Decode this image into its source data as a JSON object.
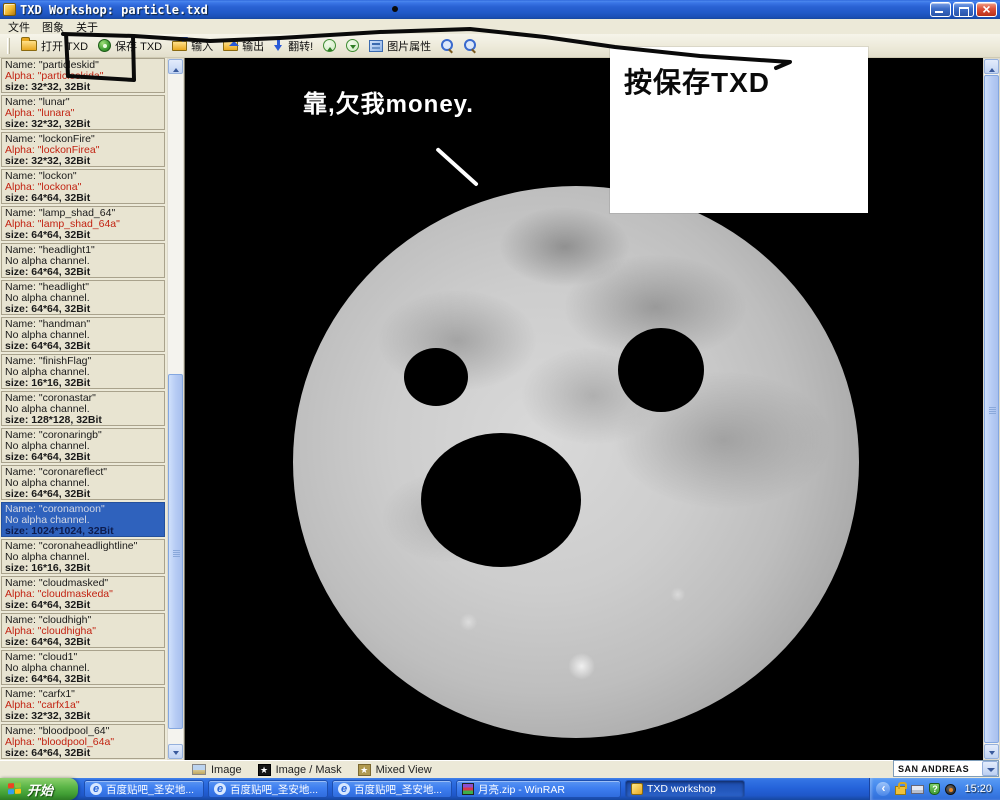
{
  "titlebar": {
    "title": "TXD Workshop: particle.txd"
  },
  "menu": {
    "items": [
      "文件",
      "图象",
      "关于"
    ]
  },
  "toolbar": {
    "buttons": [
      {
        "id": "open-txd",
        "label": "打开 TXD",
        "icon": "folder-open-icon"
      },
      {
        "id": "save-txd",
        "label": "保存 TXD",
        "icon": "save-icon"
      },
      {
        "id": "import",
        "label": "输入",
        "icon": "import-icon"
      },
      {
        "id": "export",
        "label": "输出",
        "icon": "export-icon"
      },
      {
        "id": "flip",
        "label": "翻转!",
        "icon": "flip-arrow-icon"
      },
      {
        "id": "prev-texture",
        "label": "",
        "icon": "up-circle-icon"
      },
      {
        "id": "next-texture",
        "label": "",
        "icon": "down-circle-icon"
      },
      {
        "id": "image-props",
        "label": "图片属性",
        "icon": "image-props-icon"
      },
      {
        "id": "zoom-in",
        "label": "",
        "icon": "zoom-in-icon"
      },
      {
        "id": "zoom-out",
        "label": "",
        "icon": "zoom-out-icon"
      }
    ]
  },
  "textures": [
    {
      "name_line": "Name: \"particleskid\"",
      "alpha_line": "Alpha: \"particleskida\"",
      "size_line": "size: 32*32, 32Bit",
      "has_alpha": true,
      "selected": false
    },
    {
      "name_line": "Name: \"lunar\"",
      "alpha_line": "Alpha: \"lunara\"",
      "size_line": "size: 32*32, 32Bit",
      "has_alpha": true,
      "selected": false
    },
    {
      "name_line": "Name: \"lockonFire\"",
      "alpha_line": "Alpha: \"lockonFirea\"",
      "size_line": "size: 32*32, 32Bit",
      "has_alpha": true,
      "selected": false
    },
    {
      "name_line": "Name: \"lockon\"",
      "alpha_line": "Alpha: \"lockona\"",
      "size_line": "size: 64*64, 32Bit",
      "has_alpha": true,
      "selected": false
    },
    {
      "name_line": "Name: \"lamp_shad_64\"",
      "alpha_line": "Alpha: \"lamp_shad_64a\"",
      "size_line": "size: 64*64, 32Bit",
      "has_alpha": true,
      "selected": false
    },
    {
      "name_line": "Name: \"headlight1\"",
      "alpha_line": "No alpha channel.",
      "size_line": "size: 64*64, 32Bit",
      "has_alpha": false,
      "selected": false
    },
    {
      "name_line": "Name: \"headlight\"",
      "alpha_line": "No alpha channel.",
      "size_line": "size: 64*64, 32Bit",
      "has_alpha": false,
      "selected": false
    },
    {
      "name_line": "Name: \"handman\"",
      "alpha_line": "No alpha channel.",
      "size_line": "size: 64*64, 32Bit",
      "has_alpha": false,
      "selected": false
    },
    {
      "name_line": "Name: \"finishFlag\"",
      "alpha_line": "No alpha channel.",
      "size_line": "size: 16*16, 32Bit",
      "has_alpha": false,
      "selected": false
    },
    {
      "name_line": "Name: \"coronastar\"",
      "alpha_line": "No alpha channel.",
      "size_line": "size: 128*128, 32Bit",
      "has_alpha": false,
      "selected": false
    },
    {
      "name_line": "Name: \"coronaringb\"",
      "alpha_line": "No alpha channel.",
      "size_line": "size: 64*64, 32Bit",
      "has_alpha": false,
      "selected": false
    },
    {
      "name_line": "Name: \"coronareflect\"",
      "alpha_line": "No alpha channel.",
      "size_line": "size: 64*64, 32Bit",
      "has_alpha": false,
      "selected": false
    },
    {
      "name_line": "Name: \"coronamoon\"",
      "alpha_line": "No alpha channel.",
      "size_line": "size: 1024*1024, 32Bit",
      "has_alpha": false,
      "selected": true
    },
    {
      "name_line": "Name: \"coronaheadlightline\"",
      "alpha_line": "No alpha channel.",
      "size_line": "size: 16*16, 32Bit",
      "has_alpha": false,
      "selected": false
    },
    {
      "name_line": "Name: \"cloudmasked\"",
      "alpha_line": "Alpha: \"cloudmaskeda\"",
      "size_line": "size: 64*64, 32Bit",
      "has_alpha": true,
      "selected": false
    },
    {
      "name_line": "Name: \"cloudhigh\"",
      "alpha_line": "Alpha: \"cloudhigha\"",
      "size_line": "size: 64*64, 32Bit",
      "has_alpha": true,
      "selected": false
    },
    {
      "name_line": "Name: \"cloud1\"",
      "alpha_line": "No alpha channel.",
      "size_line": "size: 64*64, 32Bit",
      "has_alpha": false,
      "selected": false
    },
    {
      "name_line": "Name: \"carfx1\"",
      "alpha_line": "Alpha: \"carfx1a\"",
      "size_line": "size: 32*32, 32Bit",
      "has_alpha": true,
      "selected": false
    },
    {
      "name_line": "Name: \"bloodpool_64\"",
      "alpha_line": "Alpha: \"bloodpool_64a\"",
      "size_line": "size: 64*64, 32Bit",
      "has_alpha": true,
      "selected": false
    }
  ],
  "canvas": {
    "caption": "靠,欠我money.",
    "note": "按保存TXD"
  },
  "statusbar": {
    "views": [
      {
        "label": "Image",
        "icon": "image-icon"
      },
      {
        "label": "Image / Mask",
        "icon": "mask-star-icon"
      },
      {
        "label": "Mixed View",
        "icon": "mixed-star-icon"
      }
    ],
    "game_select": "SAN ANDREAS"
  },
  "taskbar": {
    "start_label": "开始",
    "tasks": [
      {
        "label": "百度贴吧_圣安地...",
        "icon": "ie-icon",
        "active": false
      },
      {
        "label": "百度贴吧_圣安地...",
        "icon": "ie-icon",
        "active": false
      },
      {
        "label": "百度贴吧_圣安地...",
        "icon": "ie-icon",
        "active": false
      },
      {
        "label": "月亮.zip - WinRAR",
        "icon": "winrar-icon",
        "active": false
      },
      {
        "label": "TXD workshop",
        "icon": "txd-icon",
        "active": true
      }
    ],
    "tray_icons": [
      "collapse-chevron-icon",
      "lock-icon",
      "keyboard-icon",
      "shield-icon",
      "volume-icon"
    ],
    "clock": "15:20"
  },
  "colors": {
    "titlebar_blue": "#215ac8",
    "selection_blue": "#2f62bd",
    "alpha_red": "#c22211",
    "panel_beige": "#ece9d8",
    "taskbar_blue": "#2563da",
    "start_green": "#3f9c33"
  }
}
